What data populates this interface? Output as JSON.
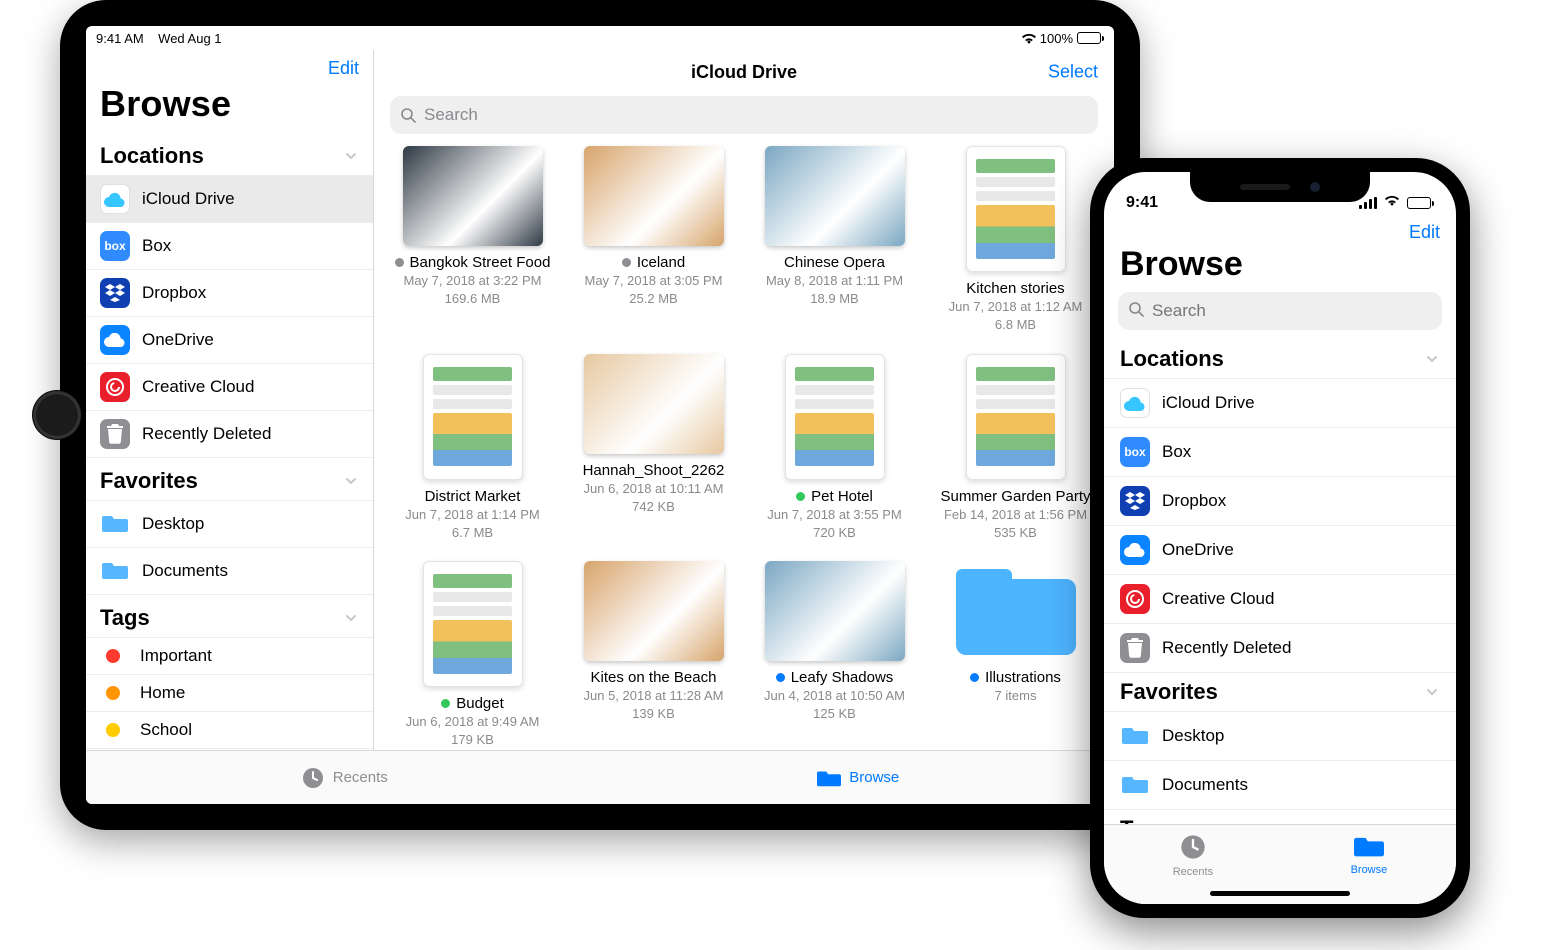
{
  "ipad": {
    "status": {
      "time": "9:41 AM",
      "date": "Wed Aug 1",
      "battery_pct": "100%"
    },
    "sidebar": {
      "edit": "Edit",
      "title": "Browse",
      "sections": {
        "locations": {
          "header": "Locations",
          "items": [
            {
              "label": "iCloud Drive",
              "icon": "cloud",
              "selected": true
            },
            {
              "label": "Box",
              "icon": "box",
              "selected": false
            },
            {
              "label": "Dropbox",
              "icon": "dropbox",
              "selected": false
            },
            {
              "label": "OneDrive",
              "icon": "onedrive",
              "selected": false
            },
            {
              "label": "Creative Cloud",
              "icon": "cc",
              "selected": false
            },
            {
              "label": "Recently Deleted",
              "icon": "trash",
              "selected": false
            }
          ]
        },
        "favorites": {
          "header": "Favorites",
          "items": [
            {
              "label": "Desktop"
            },
            {
              "label": "Documents"
            }
          ]
        },
        "tags": {
          "header": "Tags",
          "items": [
            {
              "label": "Important",
              "color": "#ff3b30"
            },
            {
              "label": "Home",
              "color": "#ff9500"
            },
            {
              "label": "School",
              "color": "#ffcc00"
            }
          ]
        }
      }
    },
    "content": {
      "title": "iCloud Drive",
      "select": "Select",
      "search_placeholder": "Search",
      "files": [
        {
          "name": "Bangkok Street Food",
          "dot": "#8e8e93",
          "meta1": "May 7, 2018 at 3:22 PM",
          "meta2": "169.6 MB",
          "thumb": "photo"
        },
        {
          "name": "Iceland",
          "dot": "#8e8e93",
          "meta1": "May 7, 2018 at 3:05 PM",
          "meta2": "25.2 MB",
          "thumb": "photo"
        },
        {
          "name": "Chinese Opera",
          "dot": null,
          "meta1": "May 8, 2018 at 1:11 PM",
          "meta2": "18.9 MB",
          "thumb": "photo"
        },
        {
          "name": "Kitchen stories",
          "dot": null,
          "meta1": "Jun 7, 2018 at 1:12 AM",
          "meta2": "6.8 MB",
          "thumb": "doc"
        },
        {
          "name": "District Market",
          "dot": null,
          "meta1": "Jun 7, 2018 at 1:14 PM",
          "meta2": "6.7 MB",
          "thumb": "doc"
        },
        {
          "name": "Hannah_Shoot_2262",
          "dot": null,
          "meta1": "Jun 6, 2018 at 10:11 AM",
          "meta2": "742 KB",
          "thumb": "photo"
        },
        {
          "name": "Pet Hotel",
          "dot": "#34c759",
          "meta1": "Jun 7, 2018 at 3:55 PM",
          "meta2": "720 KB",
          "thumb": "doc"
        },
        {
          "name": "Summer Garden Party",
          "dot": null,
          "meta1": "Feb 14, 2018 at 1:56 PM",
          "meta2": "535 KB",
          "thumb": "doc"
        },
        {
          "name": "Budget",
          "dot": "#34c759",
          "meta1": "Jun 6, 2018 at 9:49 AM",
          "meta2": "179 KB",
          "thumb": "doc"
        },
        {
          "name": "Kites on the Beach",
          "dot": null,
          "meta1": "Jun 5, 2018 at 11:28 AM",
          "meta2": "139 KB",
          "thumb": "photo"
        },
        {
          "name": "Leafy Shadows",
          "dot": "#007aff",
          "meta1": "Jun 4, 2018 at 10:50 AM",
          "meta2": "125 KB",
          "thumb": "photo"
        },
        {
          "name": "Illustrations",
          "dot": "#007aff",
          "meta1": "7 items",
          "meta2": "",
          "thumb": "folder"
        }
      ]
    },
    "tabs": {
      "recents": "Recents",
      "browse": "Browse"
    }
  },
  "iphone": {
    "status_time": "9:41",
    "edit": "Edit",
    "title": "Browse",
    "search_placeholder": "Search",
    "sections": {
      "locations": {
        "header": "Locations",
        "items": [
          {
            "label": "iCloud Drive",
            "icon": "cloud"
          },
          {
            "label": "Box",
            "icon": "box"
          },
          {
            "label": "Dropbox",
            "icon": "dropbox"
          },
          {
            "label": "OneDrive",
            "icon": "onedrive"
          },
          {
            "label": "Creative Cloud",
            "icon": "cc"
          },
          {
            "label": "Recently Deleted",
            "icon": "trash"
          }
        ]
      },
      "favorites": {
        "header": "Favorites",
        "items": [
          {
            "label": "Desktop"
          },
          {
            "label": "Documents"
          }
        ]
      },
      "tags": {
        "header": "Tags"
      }
    },
    "tabs": {
      "recents": "Recents",
      "browse": "Browse"
    }
  },
  "thumb_colors": {
    "photo": [
      "#2e3944",
      "#d7a46b",
      "#7ba7c2",
      "#f1d8c8",
      "#3b5b42",
      "#e6c8a0",
      "#344b35",
      "#a8c4dd"
    ],
    "doc": [
      "#fff",
      "#fff",
      "#fff",
      "#fff"
    ]
  }
}
